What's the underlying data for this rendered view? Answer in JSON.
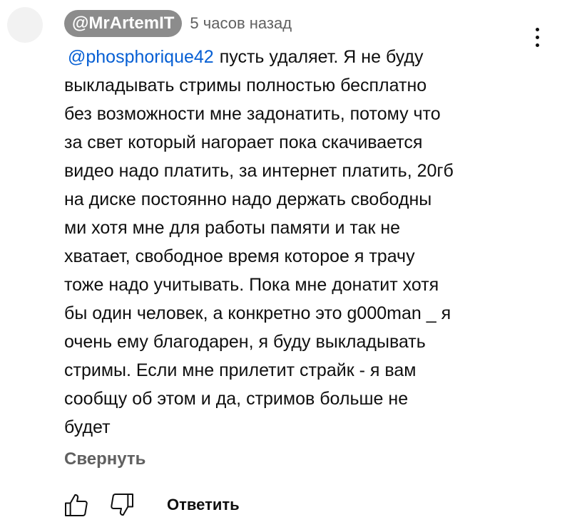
{
  "comment": {
    "author": "@MrArtemIT",
    "timestamp": "5 часов назад",
    "mention": "@phosphorique42",
    "lines": [
      "пусть удаляет. Я не буду",
      "выкладывать стримы полностью бесплатно",
      "без возможности мне задонатить, потому что",
      "за свет который нагорает пока скачивается",
      "видео надо платить, за интернет платить, 20гб",
      "на диске постоянно надо держать свободны",
      "ми хотя мне для работы памяти и так не",
      "хватает, свободное время которое я трачу",
      "тоже надо учитывать. Пока мне донатит хотя",
      "бы один человек, а конкретно это g000man _ я",
      "очень ему благодарен, я буду выкладывать",
      "стримы. Если мне прилетит страйк - я вам",
      "сообщу об этом и да, стримов больше не",
      "будет"
    ],
    "collapse_label": "Свернуть"
  },
  "actions": {
    "like_icon": "thumbs-up-icon",
    "dislike_icon": "thumbs-down-icon",
    "reply_label": "Ответить"
  },
  "menu_icon": "more-vertical-icon",
  "colors": {
    "author_chip_bg": "#8c8c8c",
    "mention_link": "#065fd4",
    "secondary_text": "#606060",
    "primary_text": "#0f0f0f",
    "avatar_placeholder": "#f2f2f2"
  }
}
